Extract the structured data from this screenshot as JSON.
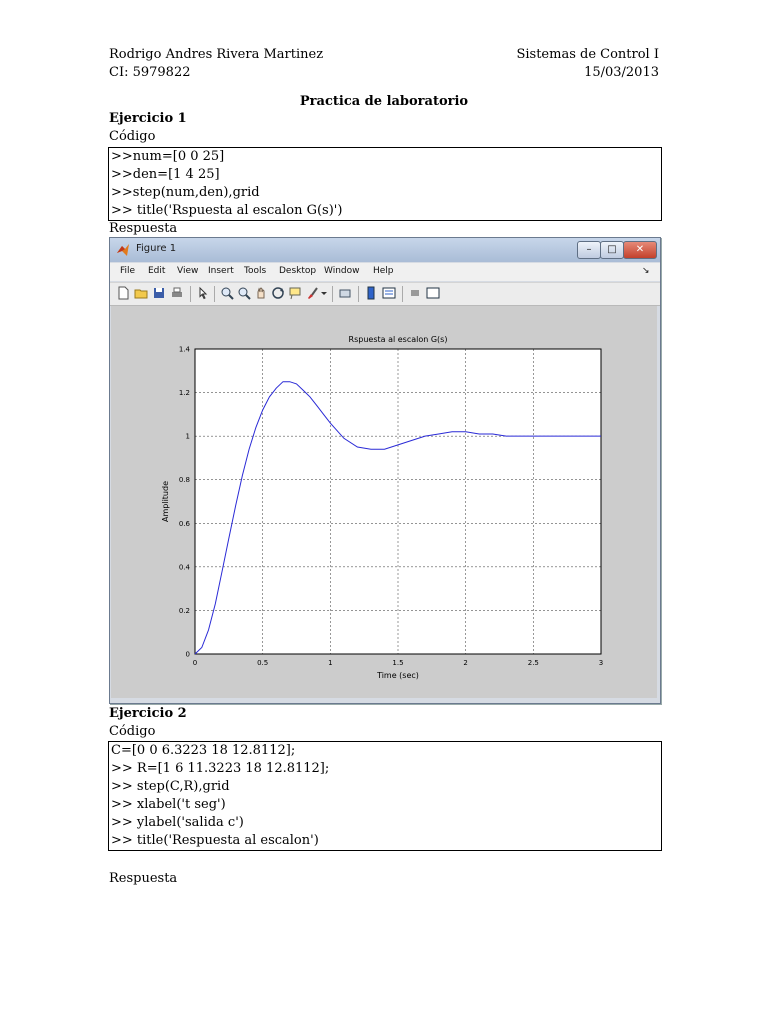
{
  "header": {
    "author": "Rodrigo Andres Rivera Martinez",
    "ci": "CI: 5979822",
    "course": "Sistemas de Control I",
    "date": "15/03/2013"
  },
  "doc_title": "Practica de laboratorio",
  "ex1": {
    "heading": "Ejercicio 1",
    "code_label": "Código",
    "code_lines": [
      ">>num=[0 0 25]",
      ">>den=[1 4 25]",
      ">>step(num,den),grid",
      ">> title('Rspuesta al escalon G(s)')"
    ],
    "response_label": "Respuesta"
  },
  "figure": {
    "window_title": "Figure 1",
    "window_buttons": {
      "minimize": "–",
      "maximize": "□",
      "close": "✕"
    },
    "menu": [
      "File",
      "Edit",
      "View",
      "Insert",
      "Tools",
      "Desktop",
      "Window",
      "Help"
    ],
    "menu_arrow": "↘",
    "toolbar_icons": [
      "new-file-icon",
      "open-folder-icon",
      "save-icon",
      "print-icon",
      "pointer-icon",
      "zoom-in-icon",
      "zoom-out-icon",
      "pan-icon",
      "rotate-icon",
      "data-cursor-icon",
      "brush-icon",
      "link-icon",
      "colorbar-icon",
      "legend-icon",
      "hide-plot-icon",
      "show-plot-icon"
    ],
    "colors": {
      "line": "#2a2ad6",
      "plot_bg": "#ffffff",
      "figure_bg": "#cccccc"
    }
  },
  "chart_data": {
    "type": "line",
    "title": "Rspuesta al escalon G(s)",
    "xlabel": "Time (sec)",
    "ylabel": "Amplitude",
    "xlim": [
      0,
      3
    ],
    "ylim": [
      0,
      1.4
    ],
    "xticks": [
      "0",
      "0.5",
      "1",
      "1.5",
      "2",
      "2.5",
      "3"
    ],
    "yticks": [
      "0",
      "0.2",
      "0.4",
      "0.6",
      "0.8",
      "1",
      "1.2",
      "1.4"
    ],
    "grid": true,
    "series": [
      {
        "x": [
          0,
          0.05,
          0.1,
          0.15,
          0.2,
          0.25,
          0.3,
          0.35,
          0.4,
          0.45,
          0.5,
          0.55,
          0.6,
          0.65,
          0.7,
          0.75,
          0.8,
          0.85,
          0.9,
          0.95,
          1.0,
          1.1,
          1.2,
          1.3,
          1.4,
          1.5,
          1.6,
          1.7,
          1.8,
          1.9,
          2.0,
          2.1,
          2.2,
          2.3,
          2.4,
          2.5,
          2.6,
          2.8,
          3.0
        ],
        "y": [
          0,
          0.03,
          0.11,
          0.23,
          0.38,
          0.53,
          0.68,
          0.82,
          0.94,
          1.04,
          1.12,
          1.18,
          1.22,
          1.25,
          1.25,
          1.24,
          1.21,
          1.18,
          1.14,
          1.1,
          1.06,
          0.99,
          0.95,
          0.94,
          0.94,
          0.96,
          0.98,
          1.0,
          1.01,
          1.02,
          1.02,
          1.01,
          1.01,
          1.0,
          1.0,
          1.0,
          1.0,
          1.0,
          1.0
        ]
      }
    ]
  },
  "ex2": {
    "heading": "Ejercicio 2",
    "code_label": "Código",
    "code_lines": [
      "C=[0 0 6.3223 18 12.8112];",
      ">> R=[1 6 11.3223 18 12.8112];",
      ">> step(C,R),grid",
      ">> xlabel('t seg')",
      ">> ylabel('salida c')",
      ">> title('Respuesta al escalon')"
    ],
    "response_label": "Respuesta"
  }
}
